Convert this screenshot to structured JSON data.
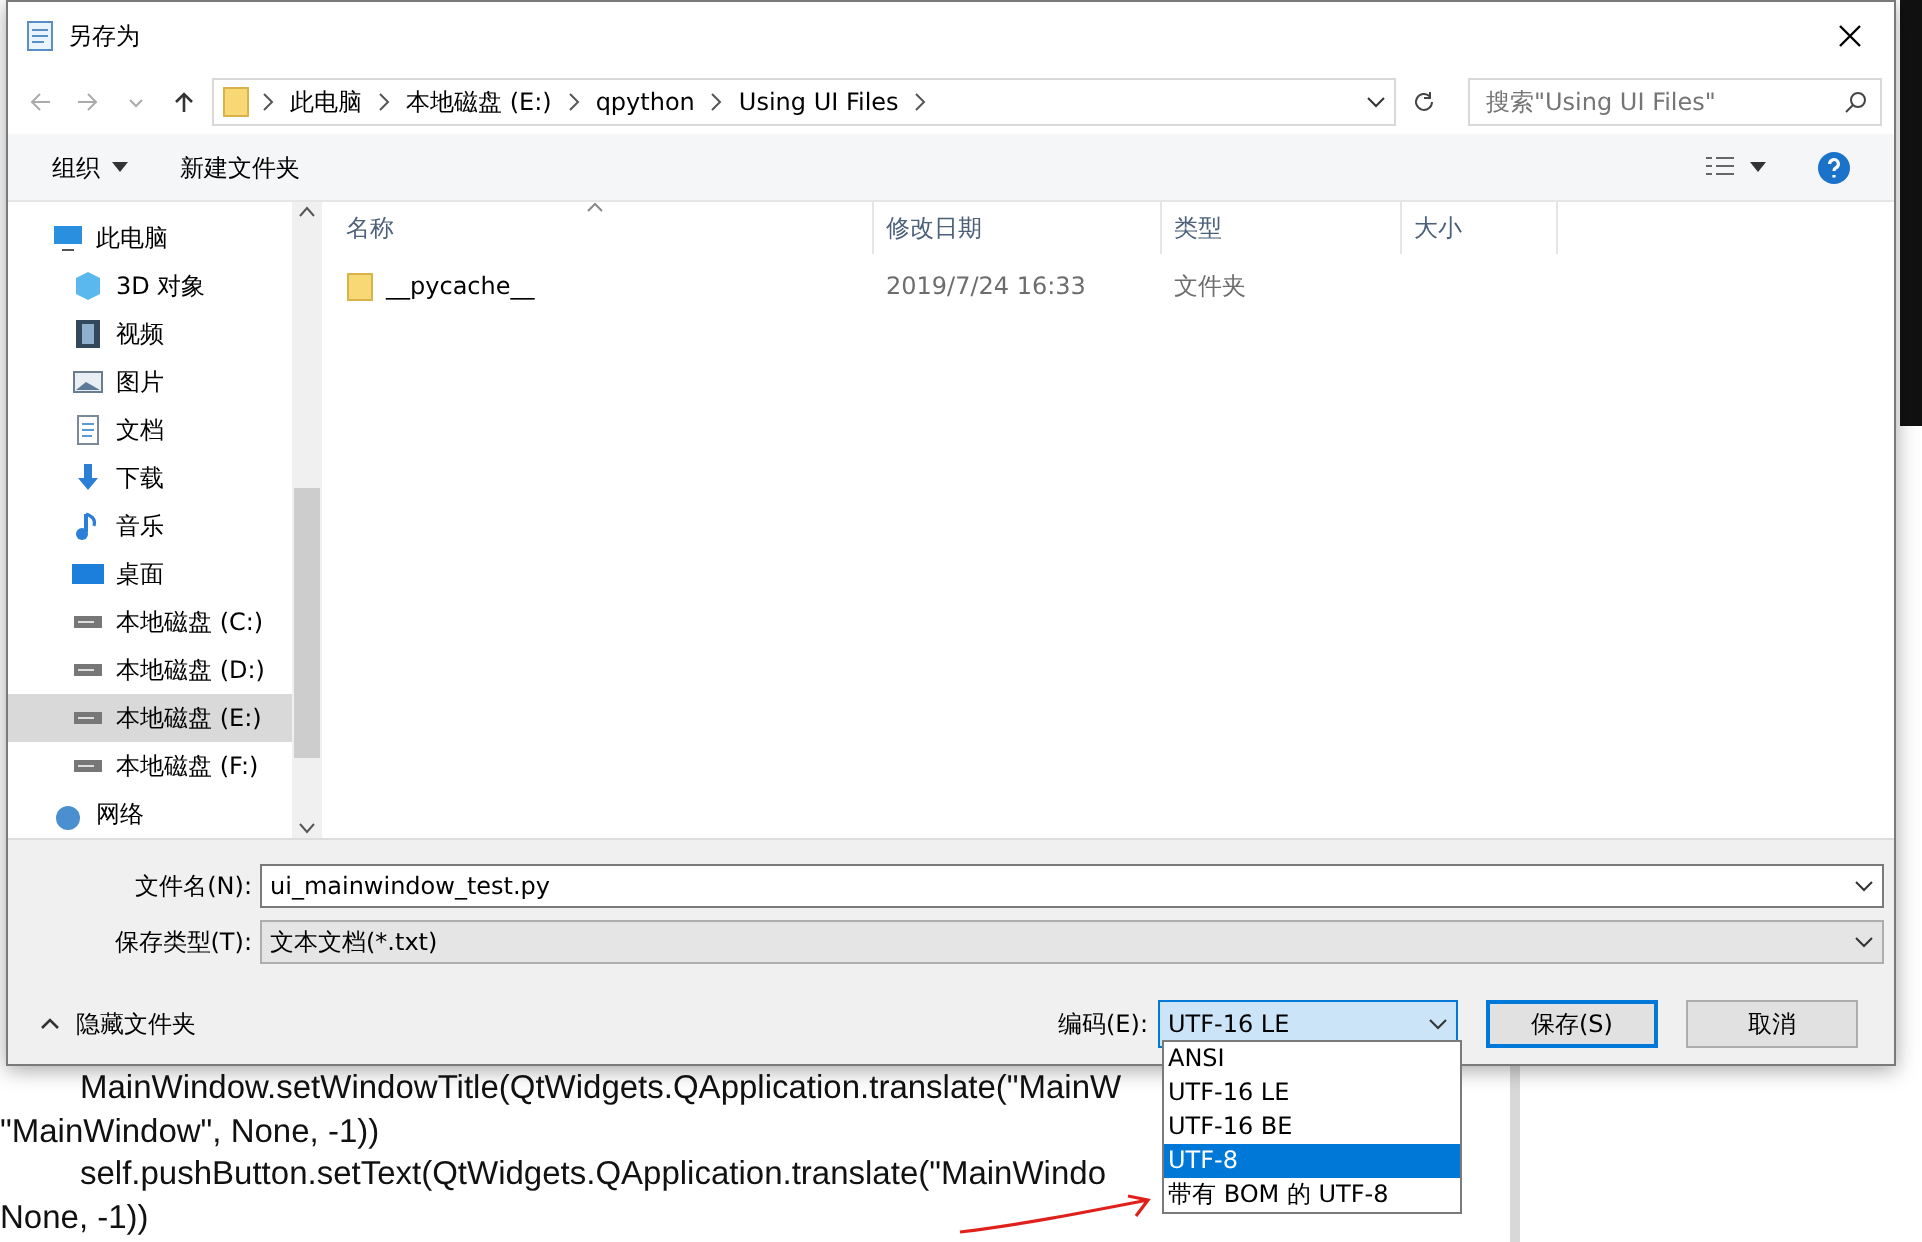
{
  "editor_lines": [
    {
      "text": "MainWindow.setWindowTitle(QtWidgets.QApplication.translate(\"MainW",
      "indented": true
    },
    {
      "text": "\"MainWindow\", None, -1))",
      "indented": false
    },
    {
      "text": "self.pushButton.setText(QtWidgets.QApplication.translate(\"MainWindo",
      "indented": true
    },
    {
      "text": "None, -1))",
      "indented": false
    }
  ],
  "window": {
    "title": "另存为"
  },
  "breadcrumb": [
    "此电脑",
    "本地磁盘 (E:)",
    "qpython",
    "Using UI Files"
  ],
  "search": {
    "placeholder": "搜索\"Using UI Files\""
  },
  "toolbar": [
    {
      "label": "组织",
      "kind": "menu"
    },
    {
      "label": "新建文件夹",
      "kind": "button"
    }
  ],
  "sidebar": {
    "items": [
      {
        "label": "此电脑",
        "kind": "computer",
        "selected": false,
        "children": [
          {
            "label": "3D 对象",
            "kind": "cube",
            "selected": false
          },
          {
            "label": "视频",
            "kind": "film",
            "selected": false
          },
          {
            "label": "图片",
            "kind": "image",
            "selected": false
          },
          {
            "label": "文档",
            "kind": "document",
            "selected": false
          },
          {
            "label": "下载",
            "kind": "download",
            "selected": false
          },
          {
            "label": "音乐",
            "kind": "music",
            "selected": false
          },
          {
            "label": "桌面",
            "kind": "desktop",
            "selected": false
          },
          {
            "label": "本地磁盘 (C:)",
            "kind": "drive",
            "selected": false
          },
          {
            "label": "本地磁盘 (D:)",
            "kind": "drive",
            "selected": false
          },
          {
            "label": "本地磁盘 (E:)",
            "kind": "drive",
            "selected": true
          },
          {
            "label": "本地磁盘 (F:)",
            "kind": "drive",
            "selected": false
          }
        ]
      },
      {
        "label": "网络",
        "kind": "network",
        "selected": false
      }
    ]
  },
  "table": {
    "columns": [
      {
        "label": "名称",
        "sorted": true
      },
      {
        "label": "修改日期",
        "sorted": false
      },
      {
        "label": "类型",
        "sorted": false
      },
      {
        "label": "大小",
        "sorted": false
      }
    ],
    "rows": [
      {
        "name": "__pycache__",
        "modified": "2019/7/24 16:33",
        "type": "文件夹"
      }
    ]
  },
  "filename": {
    "label": "文件名(N):",
    "value": "ui_mainwindow_test.py"
  },
  "filetype": {
    "label": "保存类型(T):",
    "value": "文本文档(*.txt)"
  },
  "hide_folders": "隐藏文件夹",
  "encoding": {
    "label": "编码(E):",
    "value": "UTF-16 LE",
    "expanded": true,
    "options": [
      {
        "label": "ANSI",
        "highlighted": false
      },
      {
        "label": "UTF-16 LE",
        "highlighted": false
      },
      {
        "label": "UTF-16 BE",
        "highlighted": false
      },
      {
        "label": "UTF-8",
        "highlighted": true
      },
      {
        "label": "带有 BOM 的 UTF-8",
        "highlighted": false
      }
    ]
  },
  "buttons": [
    {
      "label": "保存(S)",
      "default": true
    },
    {
      "label": "取消",
      "default": false
    }
  ]
}
